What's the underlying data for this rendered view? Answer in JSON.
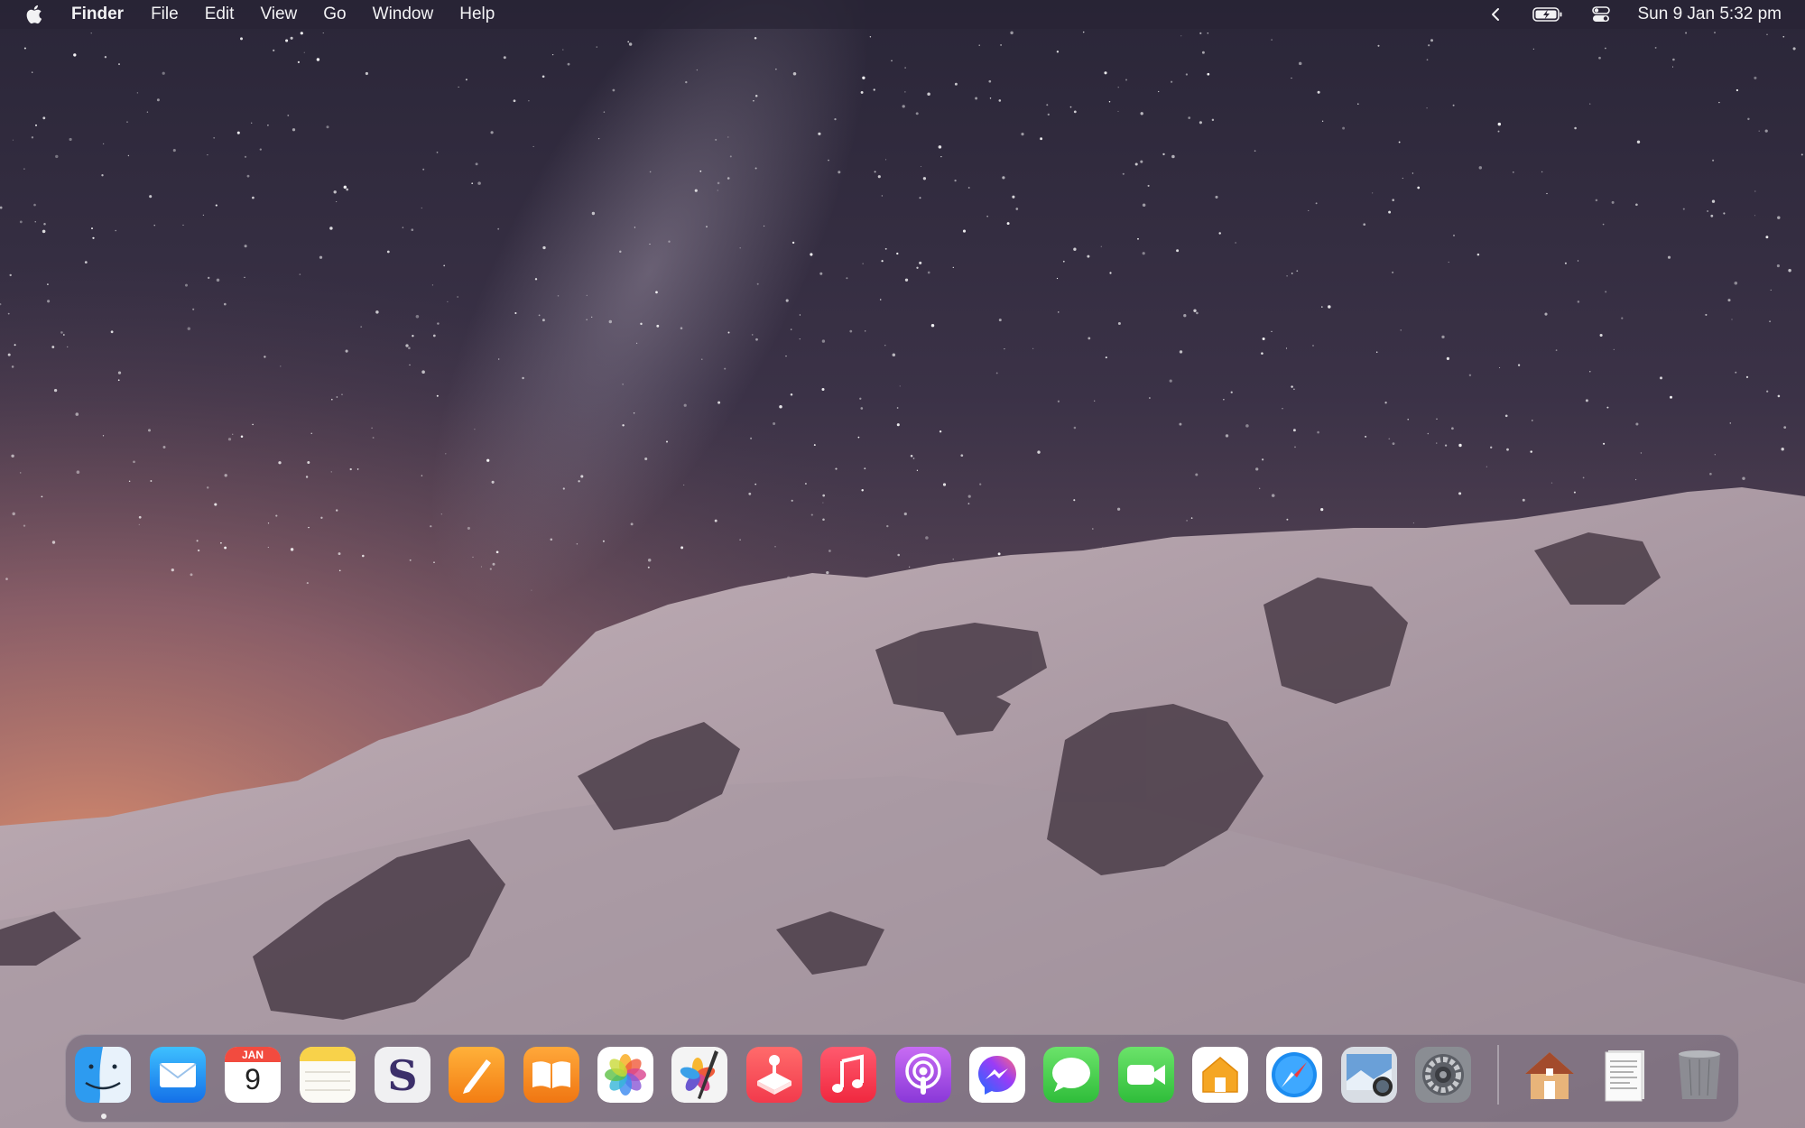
{
  "menubar": {
    "apple_icon": "apple-logo-icon",
    "app_name": "Finder",
    "menus": [
      "File",
      "Edit",
      "View",
      "Go",
      "Window",
      "Help"
    ],
    "status_icons": [
      "chevron-left-icon",
      "battery-charging-icon",
      "control-center-icon"
    ],
    "clock": "Sun 9 Jan  5:32 pm"
  },
  "desktop": {
    "wallpaper": "starry-night-snow-mountain"
  },
  "dock": {
    "items": [
      {
        "name": "finder-icon",
        "running": true
      },
      {
        "name": "mail-icon"
      },
      {
        "name": "calendar-icon",
        "month": "JAN",
        "day": "9"
      },
      {
        "name": "notes-icon"
      },
      {
        "name": "scrivener-icon"
      },
      {
        "name": "pages-icon"
      },
      {
        "name": "books-icon"
      },
      {
        "name": "photos-icon"
      },
      {
        "name": "pixelmator-icon"
      },
      {
        "name": "arcade-icon"
      },
      {
        "name": "music-icon"
      },
      {
        "name": "podcasts-icon"
      },
      {
        "name": "messenger-icon"
      },
      {
        "name": "messages-icon"
      },
      {
        "name": "facetime-icon"
      },
      {
        "name": "home-icon"
      },
      {
        "name": "safari-icon"
      },
      {
        "name": "preview-icon"
      },
      {
        "name": "system-preferences-icon"
      },
      {
        "name": "home-folder-icon"
      },
      {
        "name": "documents-stack-icon"
      },
      {
        "name": "trash-icon"
      }
    ]
  },
  "colors": {
    "menubar_bg": "#2a2434",
    "sky_top": "#2a2638",
    "sky_glow": "#d8896a",
    "snow": "#b7a5ae"
  }
}
